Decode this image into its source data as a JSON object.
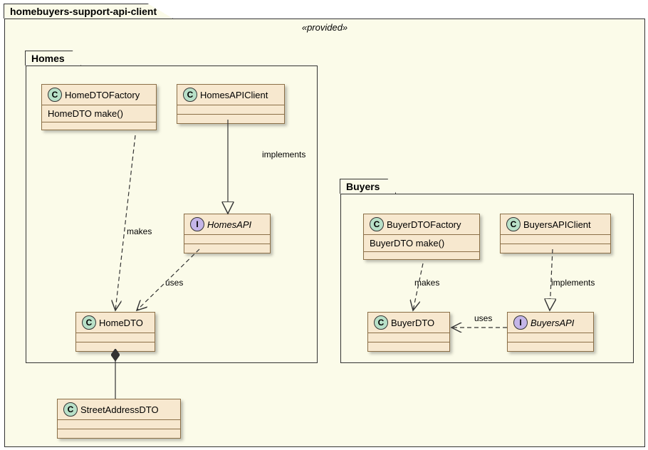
{
  "outerPackage": {
    "name": "homebuyers-support-api-client",
    "stereotype": "«provided»"
  },
  "homesPackage": {
    "name": "Homes",
    "classes": {
      "homeDTOFactory": {
        "name": "HomeDTOFactory",
        "method": "HomeDTO make()"
      },
      "homesAPIClient": {
        "name": "HomesAPIClient"
      },
      "homesAPI": {
        "name": "HomesAPI"
      },
      "homeDTO": {
        "name": "HomeDTO"
      }
    }
  },
  "buyersPackage": {
    "name": "Buyers",
    "classes": {
      "buyerDTOFactory": {
        "name": "BuyerDTOFactory",
        "method": "BuyerDTO make()"
      },
      "buyersAPIClient": {
        "name": "BuyersAPIClient"
      },
      "buyersAPI": {
        "name": "BuyersAPI"
      },
      "buyerDTO": {
        "name": "BuyerDTO"
      }
    }
  },
  "streetAddressDTO": {
    "name": "StreetAddressDTO"
  },
  "edges": {
    "implements1": "implements",
    "implements2": "implements",
    "makes1": "makes",
    "makes2": "makes",
    "uses1": "uses",
    "uses2": "uses"
  },
  "chart_data": {
    "type": "table",
    "description": "UML class diagram",
    "packages": [
      {
        "name": "homebuyers-support-api-client",
        "stereotype": "provided",
        "children": [
          {
            "name": "Homes",
            "classes": [
              {
                "name": "HomeDTOFactory",
                "kind": "class",
                "methods": [
                  "HomeDTO make()"
                ]
              },
              {
                "name": "HomesAPIClient",
                "kind": "class"
              },
              {
                "name": "HomesAPI",
                "kind": "interface"
              },
              {
                "name": "HomeDTO",
                "kind": "class"
              }
            ]
          },
          {
            "name": "Buyers",
            "classes": [
              {
                "name": "BuyerDTOFactory",
                "kind": "class",
                "methods": [
                  "BuyerDTO make()"
                ]
              },
              {
                "name": "BuyersAPIClient",
                "kind": "class"
              },
              {
                "name": "BuyersAPI",
                "kind": "interface"
              },
              {
                "name": "BuyerDTO",
                "kind": "class"
              }
            ]
          },
          {
            "name": "StreetAddressDTO",
            "kind": "class"
          }
        ]
      }
    ],
    "relationships": [
      {
        "from": "HomesAPIClient",
        "to": "HomesAPI",
        "type": "realization",
        "label": "implements"
      },
      {
        "from": "HomeDTOFactory",
        "to": "HomeDTO",
        "type": "dependency",
        "label": "makes"
      },
      {
        "from": "HomesAPI",
        "to": "HomeDTO",
        "type": "dependency",
        "label": "uses"
      },
      {
        "from": "HomeDTO",
        "to": "StreetAddressDTO",
        "type": "composition"
      },
      {
        "from": "BuyersAPIClient",
        "to": "BuyersAPI",
        "type": "realization",
        "label": "implements"
      },
      {
        "from": "BuyerDTOFactory",
        "to": "BuyerDTO",
        "type": "dependency",
        "label": "makes"
      },
      {
        "from": "BuyersAPI",
        "to": "BuyerDTO",
        "type": "dependency",
        "label": "uses"
      }
    ]
  }
}
